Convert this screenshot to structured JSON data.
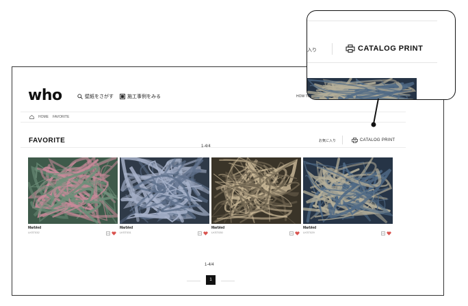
{
  "header": {
    "logo": "who",
    "nav_search": "壁紙をさがす",
    "nav_cases": "施工事例をみる",
    "howto": "HOW TO"
  },
  "breadcrumb": {
    "home": "HOME",
    "current": "FAVORITE"
  },
  "page": {
    "title": "FAVORITE",
    "favorites_link": "お気に入り",
    "catalog_print": "CATALOG PRINT",
    "count_top": "1-4/4",
    "count_bottom": "1-4/4"
  },
  "cards": [
    {
      "name": "Marbled",
      "code": "LKST032",
      "palette": [
        "#3e5a4a",
        "#c88a9a",
        "#6e8f7a"
      ]
    },
    {
      "name": "Marbled",
      "code": "LKST031",
      "palette": [
        "#2f3a48",
        "#a9b4cc",
        "#5d6f8a"
      ]
    },
    {
      "name": "Marbled",
      "code": "LKST030",
      "palette": [
        "#3a3428",
        "#cdbb9a",
        "#6f6450"
      ]
    },
    {
      "name": "Marbled",
      "code": "LKST029",
      "palette": [
        "#263446",
        "#b7b09a",
        "#4f6a86"
      ]
    }
  ],
  "pagination": {
    "current": "1"
  },
  "callout": {
    "favorites_fragment": "入り",
    "catalog_print": "CATALOG PRINT"
  },
  "colors": {
    "accent": "#d9534f",
    "pager_bg": "#111111"
  }
}
